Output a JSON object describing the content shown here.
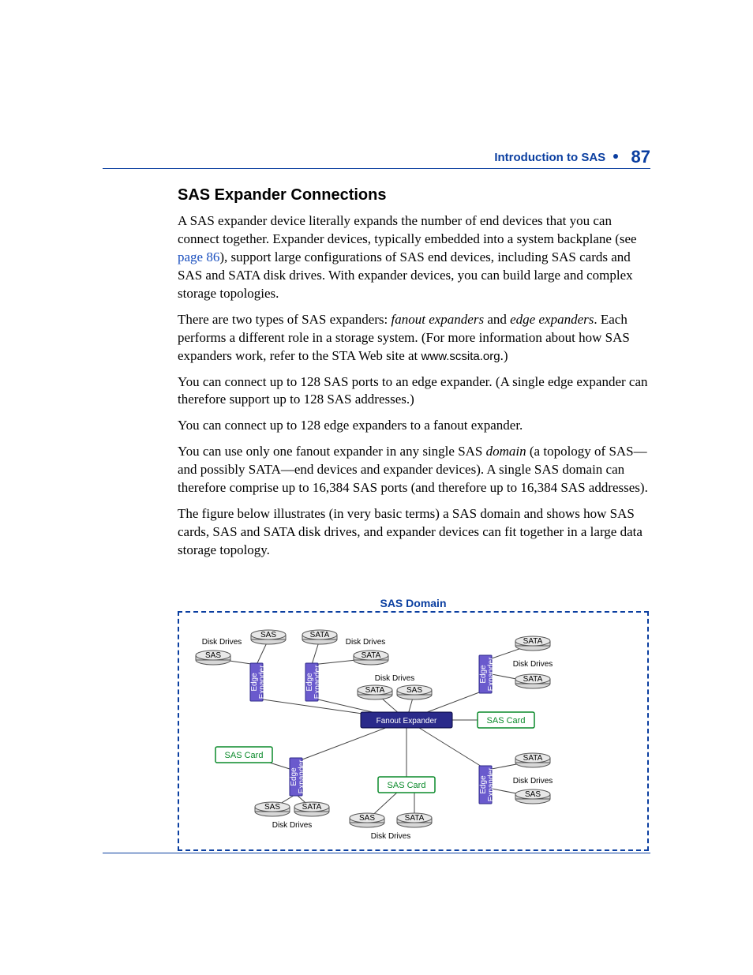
{
  "header": {
    "running": "Introduction to SAS",
    "page": "87"
  },
  "section_title": "SAS Expander Connections",
  "paragraphs": {
    "p1a": "A SAS expander device literally expands the number of end devices that you can connect together. Expander devices, typically embedded into a system backplane (see ",
    "p1link": "page 86",
    "p1b": "), support large configurations of SAS end devices, including SAS cards and SAS and SATA disk drives. With expander devices, you can build large and complex storage topologies.",
    "p2a": "There are two types of SAS expanders: ",
    "p2em1": "fanout expanders",
    "p2mid": " and ",
    "p2em2": "edge expanders",
    "p2b": ". Each performs a different role in a storage system. (For more information about how SAS expanders work, refer to the STA Web site at ",
    "p2mono": "www.scsita.org",
    "p2c": ".)",
    "p3": "You can connect up to 128 SAS ports to an edge expander. (A single edge expander can therefore support up to 128 SAS addresses.)",
    "p4": "You can connect up to 128 edge expanders to a fanout expander.",
    "p5a": "You can use only one fanout expander in any single SAS ",
    "p5em": "domain",
    "p5b": " (a topology of SAS—and possibly SATA—end devices and expander devices). A single SAS domain can therefore comprise up to 16,384 SAS ports (and therefore up to 16,384 SAS addresses).",
    "p6": "The figure below illustrates (in very basic terms) a SAS domain and shows how SAS cards, SAS and SATA disk drives, and expander devices can fit together in a large data storage topology."
  },
  "figure": {
    "title": "SAS Domain",
    "fanout": "Fanout Expander",
    "edge_l1": "Edge",
    "edge_l2": "Expander",
    "sas_card": "SAS Card",
    "disk_drives": "Disk Drives",
    "drive_sas": "SAS",
    "drive_sata": "SATA"
  }
}
